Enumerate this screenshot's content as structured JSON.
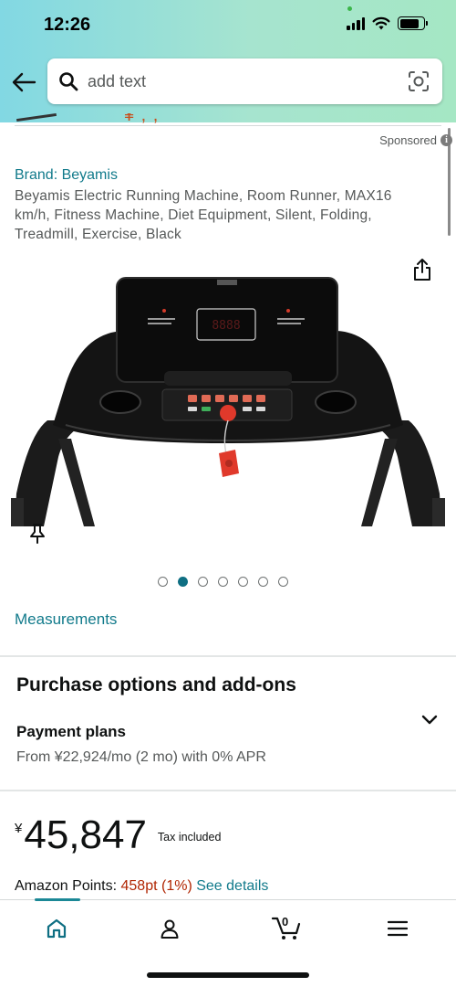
{
  "status_bar": {
    "time": "12:26"
  },
  "search": {
    "placeholder": "add text"
  },
  "ad": {
    "sponsored_label": "Sponsored"
  },
  "product": {
    "brand": "Brand: Beyamis",
    "title": "Beyamis Electric Running Machine, Room Runner, MAX16 km/h, Fitness Machine, Diet Equipment, Silent, Folding, Treadmill, Exercise, Black",
    "display_readout": "8888",
    "image_count": 7,
    "active_image_index": 1,
    "measurements_label": "Measurements"
  },
  "purchase_options": {
    "heading": "Purchase options and add-ons",
    "payment_plans_label": "Payment plans",
    "payment_plans_detail": "From ¥22,924/mo (2 mo) with 0% APR"
  },
  "pricing": {
    "currency_symbol": "¥",
    "price": "45,847",
    "tax_note": "Tax included"
  },
  "points": {
    "label": "Amazon Points: ",
    "value": "458pt",
    "percent": "(1%)",
    "link": "See details"
  },
  "bottom_nav": {
    "items": [
      "home-icon",
      "account-icon",
      "cart-icon",
      "menu-icon"
    ],
    "cart_count": "0",
    "active": "home"
  },
  "colors": {
    "header_gradient_start": "#82d8e3",
    "header_gradient_end": "#a5e7c4",
    "link": "#117a8b",
    "price_orange": "#b12704",
    "active_dot": "#0f6f83"
  }
}
